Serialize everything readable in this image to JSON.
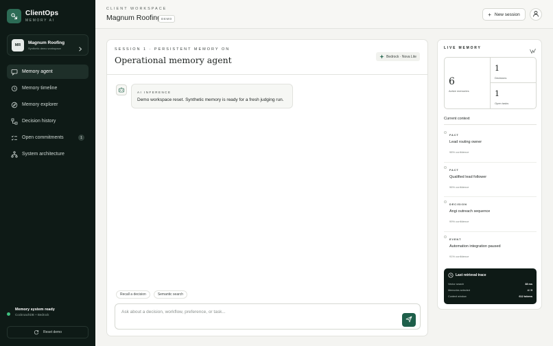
{
  "brand": {
    "name": "ClientOps",
    "subtitle": "MEMORY AI"
  },
  "workspace_card": {
    "initials": "MR",
    "name": "Magnum Roofing",
    "description": "Synthetic demo workspace"
  },
  "nav": {
    "items": [
      {
        "label": "Memory agent",
        "icon": "message-square-icon",
        "active": true
      },
      {
        "label": "Memory timeline",
        "icon": "history-icon"
      },
      {
        "label": "Memory explorer",
        "icon": "compass-icon"
      },
      {
        "label": "Decision history",
        "icon": "workflow-icon"
      },
      {
        "label": "Open commitments",
        "icon": "list-checks-icon",
        "badge": "1"
      },
      {
        "label": "System architecture",
        "icon": "network-icon"
      }
    ]
  },
  "system": {
    "status_title": "Memory system ready",
    "status_sub": "CockroachDB + Bedrock",
    "reset_label": "Reset demo"
  },
  "header": {
    "crumb": "CLIENT WORKSPACE",
    "title": "Magnum Roofing",
    "badge": "DEMO",
    "new_session_label": "New session"
  },
  "main": {
    "session_label": "SESSION 1 · PERSISTENT MEMORY ON",
    "title": "Operational memory agent",
    "model_pill": "Bedrock · Nova Lite",
    "message": {
      "label": "AI INFERENCE",
      "text": "Demo workspace reset. Synthetic memory is ready for a fresh judging run."
    },
    "chips": [
      "Recall a decision",
      "Semantic search"
    ],
    "composer_placeholder": "Ask about a decision, workflow, preference, or task..."
  },
  "memory": {
    "title": "LIVE MEMORY",
    "active_count": "6",
    "active_label": "Active memories",
    "decisions_count": "1",
    "decisions_label": "Decisions",
    "tasks_count": "1",
    "tasks_label": "Open tasks",
    "context_title": "Current context",
    "context": [
      {
        "kind": "FACT",
        "text": "Lead routing owner",
        "confidence": "98% confidence"
      },
      {
        "kind": "FACT",
        "text": "Qualified lead follower",
        "confidence": "96% confidence"
      },
      {
        "kind": "DECISION",
        "text": "Angi outreach sequence",
        "confidence": "99% confidence"
      },
      {
        "kind": "EVENT",
        "text": "Automation integration paused",
        "confidence": "91% confidence"
      }
    ],
    "trace": {
      "title": "Last retrieval trace",
      "rows": [
        {
          "label": "Vector search",
          "value": "38 ms"
        },
        {
          "label": "Memories selected",
          "value": "4 / 9"
        },
        {
          "label": "Context window",
          "value": "612 tokens"
        }
      ]
    }
  },
  "colors": {
    "sidebar_bg": "#0e1a16",
    "accent": "#1e5f4a",
    "status_ok": "#3fbf7f"
  }
}
